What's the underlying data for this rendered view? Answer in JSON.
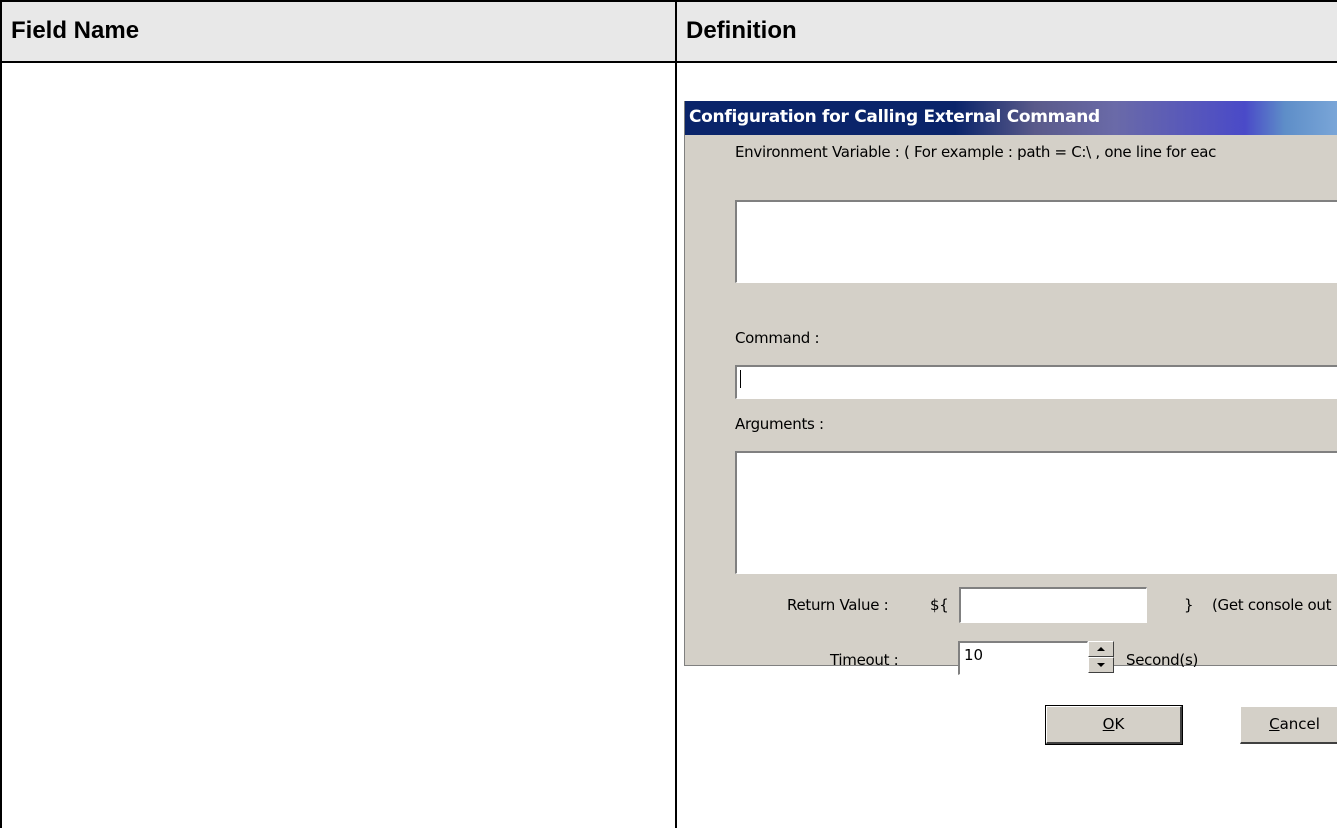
{
  "table": {
    "header_field_name": "Field Name",
    "header_definition": "Definition"
  },
  "dialog": {
    "title": "Configuration for Calling External Command",
    "env_label": "Environment Variable : ( For example : path = C:\\ , one line for eac",
    "env_value": "",
    "command_label": "Command :",
    "command_value": "",
    "arguments_label": "Arguments :",
    "arguments_value": "",
    "return_label": "Return Value :",
    "return_prefix": "${",
    "return_value": "",
    "return_suffix": "}",
    "return_hint": "(Get console out",
    "timeout_label": "Timeout :",
    "timeout_value": "10",
    "timeout_unit": "Second(s)",
    "ok_mnemonic": "O",
    "ok_rest": "K",
    "cancel_mnemonic": "C",
    "cancel_rest": "ancel"
  },
  "colors": {
    "titlebar_start": "#0a246a",
    "dialog_face": "#d4d0c8"
  }
}
